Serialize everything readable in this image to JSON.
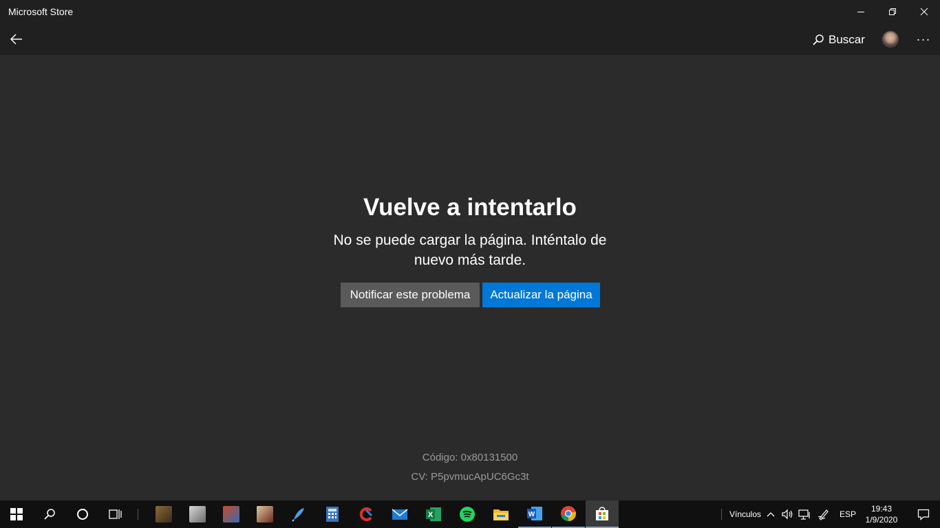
{
  "window": {
    "title": "Microsoft Store"
  },
  "header": {
    "search_label": "Buscar",
    "more_label": "···"
  },
  "error": {
    "title": "Vuelve a intentarlo",
    "message": "No se puede cargar la página. Inténtalo de nuevo más tarde.",
    "notify_button": "Notificar este problema",
    "refresh_button": "Actualizar la página",
    "code": "Código: 0x80131500",
    "cv": "CV: P5pvmucApUC6Gc3t"
  },
  "taskbar": {
    "pinned_apps": [
      {
        "name": "start-icon"
      },
      {
        "name": "search-icon"
      },
      {
        "name": "cortana-icon"
      },
      {
        "name": "task-view-icon"
      },
      {
        "name": "game-app-1-icon"
      },
      {
        "name": "counter-strike-icon"
      },
      {
        "name": "game-app-2-icon"
      },
      {
        "name": "game-app-3-icon"
      },
      {
        "name": "feather-app-icon"
      },
      {
        "name": "calculator-icon"
      },
      {
        "name": "ccleaner-icon"
      },
      {
        "name": "mail-icon"
      },
      {
        "name": "excel-icon"
      },
      {
        "name": "spotify-icon"
      },
      {
        "name": "file-explorer-icon"
      },
      {
        "name": "word-icon"
      },
      {
        "name": "chrome-icon"
      },
      {
        "name": "microsoft-store-icon"
      }
    ],
    "links_label": "Vínculos",
    "language": "ESP",
    "time": "19:43",
    "date": "1/9/2020"
  },
  "colors": {
    "background": "#2b2b2b",
    "titlebar": "#202020",
    "accent": "#0078d7",
    "secondary_button": "#5a5a5a",
    "taskbar": "#101010"
  }
}
